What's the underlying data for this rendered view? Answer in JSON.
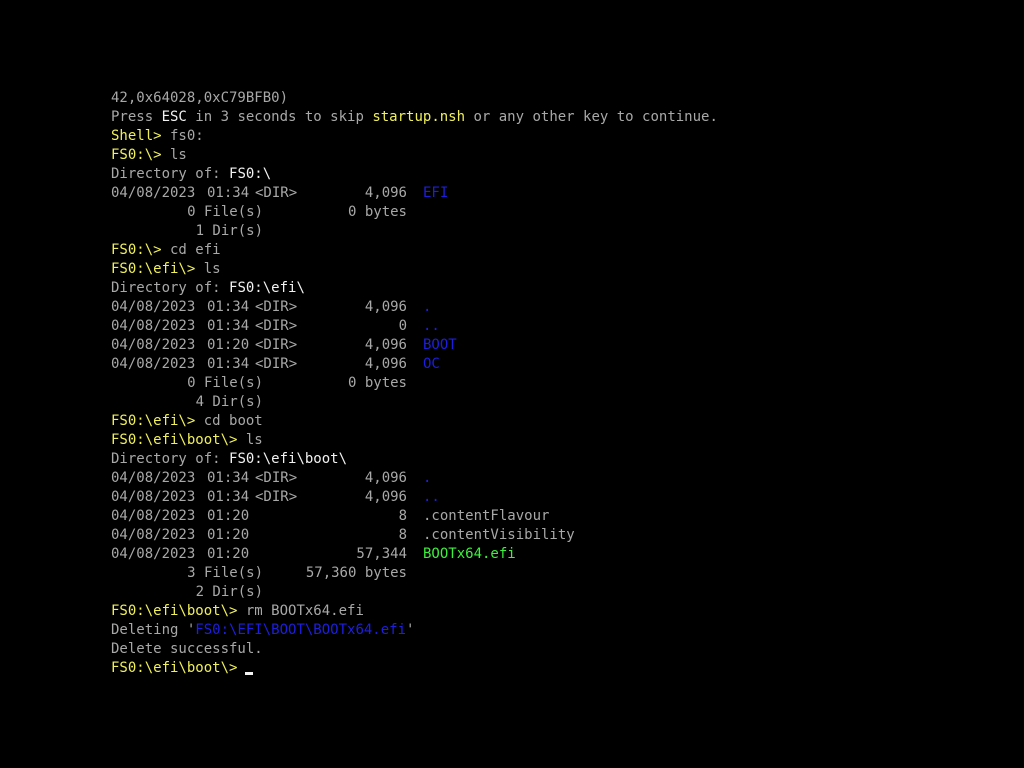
{
  "boot": {
    "addr_line": "42,0x64028,0xC79BFB0)",
    "press": "Press ",
    "esc": "ESC",
    "in_secs": " in 3 seconds to skip ",
    "startup": "startup.nsh",
    "rest": " or any other key to continue."
  },
  "shell_prompt": "Shell>",
  "cmd_fs0": " fs0:",
  "prompt_root": "FS0:\\>",
  "prompt_efi": "FS0:\\efi\\>",
  "prompt_boot": "FS0:\\efi\\boot\\>",
  "cmd_ls": " ls",
  "cmd_cd_efi": " cd efi",
  "cmd_cd_boot": " cd boot",
  "cmd_rm": " rm BOOTx64.efi",
  "dir_of_label": "Directory of: ",
  "dir_of_root": "FS0:\\",
  "dir_of_efi": "FS0:\\efi\\",
  "dir_of_boot": "FS0:\\efi\\boot\\",
  "listing_root": [
    {
      "date": "04/08/2023",
      "time": "01:34",
      "attr": "<DIR>",
      "size": "4,096",
      "name": "EFI",
      "color": "#1e1ee0"
    }
  ],
  "summary_root": {
    "files": "0 File(s)",
    "bytes": "0 bytes",
    "dirs": "1 Dir(s)"
  },
  "listing_efi": [
    {
      "date": "04/08/2023",
      "time": "01:34",
      "attr": "<DIR>",
      "size": "4,096",
      "name": ".",
      "color": "#1e1ee0"
    },
    {
      "date": "04/08/2023",
      "time": "01:34",
      "attr": "<DIR>",
      "size": "0",
      "name": "..",
      "color": "#1e1ee0"
    },
    {
      "date": "04/08/2023",
      "time": "01:20",
      "attr": "<DIR>",
      "size": "4,096",
      "name": "BOOT",
      "color": "#1e1ee0"
    },
    {
      "date": "04/08/2023",
      "time": "01:34",
      "attr": "<DIR>",
      "size": "4,096",
      "name": "OC",
      "color": "#1e1ee0"
    }
  ],
  "summary_efi": {
    "files": "0 File(s)",
    "bytes": "0 bytes",
    "dirs": "4 Dir(s)"
  },
  "listing_boot": [
    {
      "date": "04/08/2023",
      "time": "01:34",
      "attr": "<DIR>",
      "size": "4,096",
      "name": ".",
      "color": "#1e1ee0"
    },
    {
      "date": "04/08/2023",
      "time": "01:34",
      "attr": "<DIR>",
      "size": "4,096",
      "name": "..",
      "color": "#1e1ee0"
    },
    {
      "date": "04/08/2023",
      "time": "01:20",
      "attr": "",
      "size": "8",
      "name": ".contentFlavour",
      "color": "#a8a8a8"
    },
    {
      "date": "04/08/2023",
      "time": "01:20",
      "attr": "",
      "size": "8",
      "name": ".contentVisibility",
      "color": "#a8a8a8"
    },
    {
      "date": "04/08/2023",
      "time": "01:20",
      "attr": "",
      "size": "57,344",
      "name": "BOOTx64.efi",
      "color": "#3cf03c"
    }
  ],
  "summary_boot": {
    "files": "3 File(s)",
    "bytes": "57,360 bytes",
    "dirs": "2 Dir(s)"
  },
  "delete_prefix": "Deleting '",
  "delete_path": "FS0:\\EFI\\BOOT\\BOOTx64.efi",
  "delete_suffix": "'",
  "delete_result": "Delete successful.",
  "colors": {
    "background": "#000000",
    "text": "#a8a8a8",
    "highlight": "#f2f2f2",
    "prompt": "#f0f05a",
    "directory": "#1e1ee0",
    "executable": "#3cf03c"
  }
}
